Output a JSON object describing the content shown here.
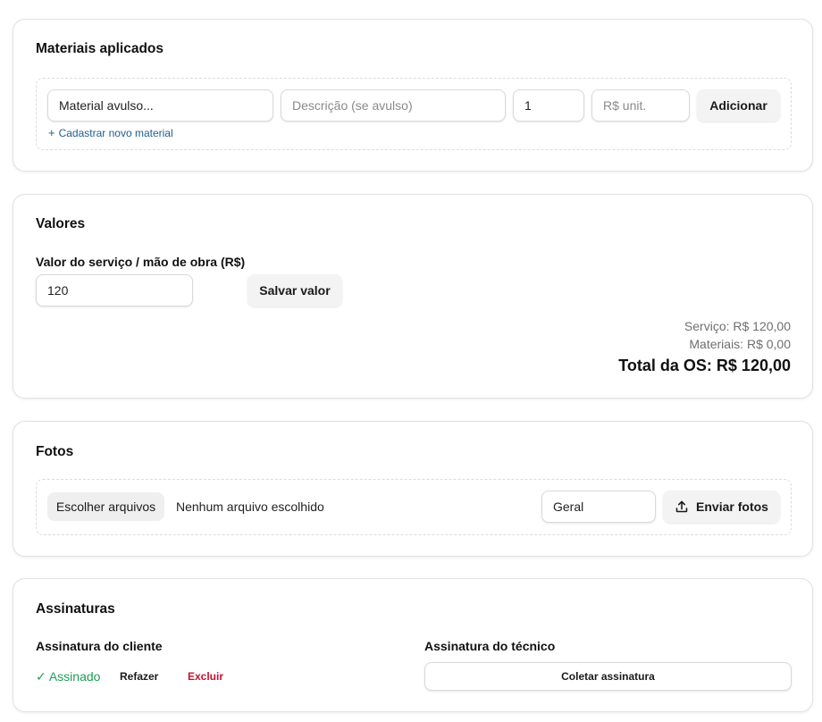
{
  "materials": {
    "title": "Materiais aplicados",
    "material_select_value": "Material avulso...",
    "description_placeholder": "Descrição (se avulso)",
    "quantity_value": "1",
    "unit_price_placeholder": "R$ unit.",
    "add_button": "Adicionar",
    "new_material_link": "Cadastrar novo material",
    "plus_glyph": "+"
  },
  "values": {
    "title": "Valores",
    "service_label": "Valor do serviço / mão de obra (R$)",
    "service_value": "120",
    "save_button": "Salvar valor",
    "summary_service": "Serviço: R$ 120,00",
    "summary_materials": "Materiais: R$ 0,00",
    "total": "Total da OS: R$ 120,00"
  },
  "photos": {
    "title": "Fotos",
    "choose_files_button": "Escolher arquivos",
    "no_file_text": "Nenhum arquivo escolhido",
    "category_value": "Geral",
    "send_button": "Enviar fotos",
    "send_icon": "upload-icon"
  },
  "signatures": {
    "title": "Assinaturas",
    "client_label": "Assinatura do cliente",
    "client_status": "✓ Assinado",
    "redo_button": "Refazer",
    "delete_button": "Excluir",
    "technician_label": "Assinatura do técnico",
    "collect_button": "Coletar assinatura"
  },
  "colors": {
    "link": "#1f5f8b",
    "success": "#1f9d55",
    "danger": "#c4122f"
  }
}
